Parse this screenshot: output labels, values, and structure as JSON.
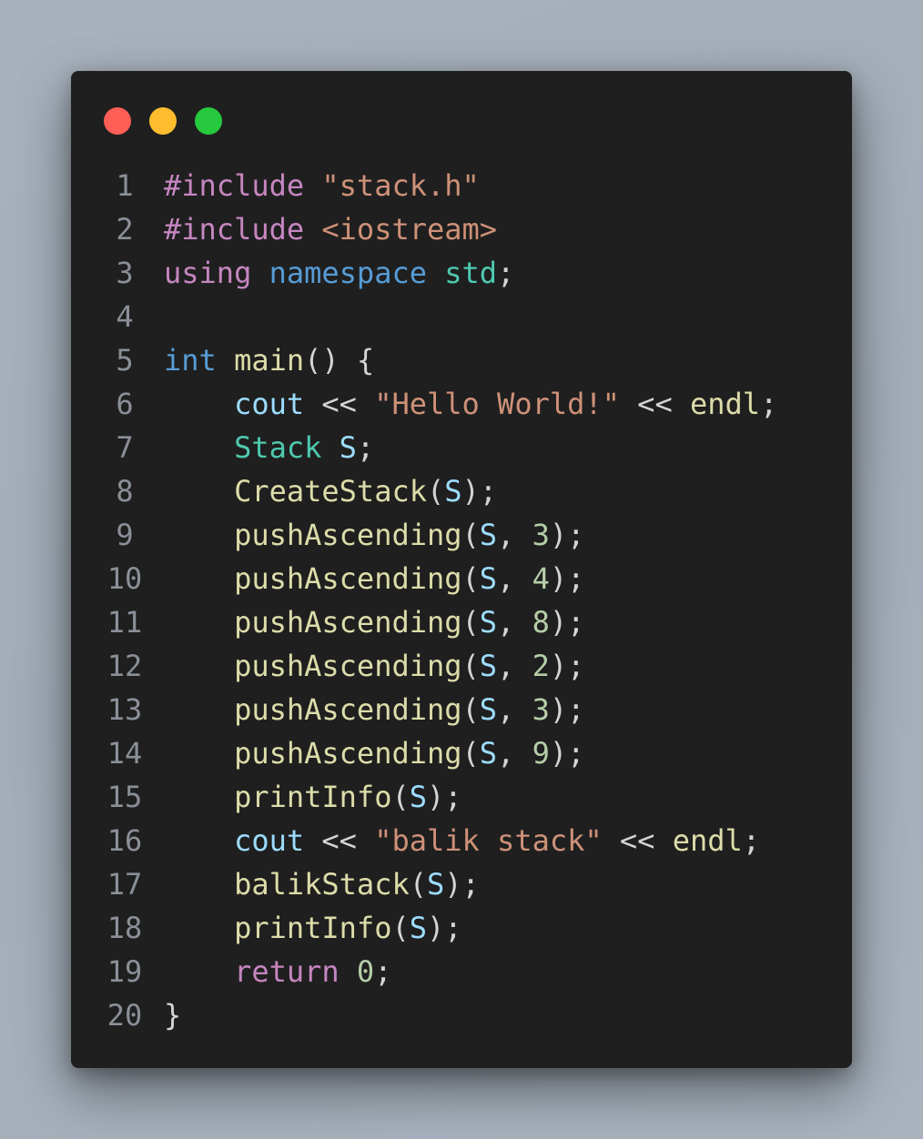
{
  "window": {
    "controls": [
      {
        "name": "close",
        "color": "#ff5f56"
      },
      {
        "name": "minimize",
        "color": "#ffbd2e"
      },
      {
        "name": "maximize",
        "color": "#27c93f"
      }
    ]
  },
  "code": {
    "language": "cpp",
    "lines": [
      {
        "num": "1",
        "tokens": [
          {
            "t": "#include",
            "c": "kw"
          },
          {
            "t": " ",
            "c": "pl"
          },
          {
            "t": "\"stack.h\"",
            "c": "str"
          }
        ]
      },
      {
        "num": "2",
        "tokens": [
          {
            "t": "#include",
            "c": "kw"
          },
          {
            "t": " ",
            "c": "pl"
          },
          {
            "t": "<iostream>",
            "c": "str"
          }
        ]
      },
      {
        "num": "3",
        "tokens": [
          {
            "t": "using",
            "c": "kw"
          },
          {
            "t": " ",
            "c": "pl"
          },
          {
            "t": "namespace",
            "c": "kb"
          },
          {
            "t": " ",
            "c": "pl"
          },
          {
            "t": "std",
            "c": "type"
          },
          {
            "t": ";",
            "c": "pl"
          }
        ]
      },
      {
        "num": "4",
        "tokens": []
      },
      {
        "num": "5",
        "tokens": [
          {
            "t": "int",
            "c": "kb"
          },
          {
            "t": " ",
            "c": "pl"
          },
          {
            "t": "main",
            "c": "fn"
          },
          {
            "t": "() {",
            "c": "pl"
          }
        ]
      },
      {
        "num": "6",
        "tokens": [
          {
            "t": "    ",
            "c": "pl"
          },
          {
            "t": "cout",
            "c": "var"
          },
          {
            "t": " << ",
            "c": "pl"
          },
          {
            "t": "\"Hello World!\"",
            "c": "str"
          },
          {
            "t": " << ",
            "c": "pl"
          },
          {
            "t": "endl",
            "c": "fn"
          },
          {
            "t": ";",
            "c": "pl"
          }
        ]
      },
      {
        "num": "7",
        "tokens": [
          {
            "t": "    ",
            "c": "pl"
          },
          {
            "t": "Stack",
            "c": "type"
          },
          {
            "t": " ",
            "c": "pl"
          },
          {
            "t": "S",
            "c": "var"
          },
          {
            "t": ";",
            "c": "pl"
          }
        ]
      },
      {
        "num": "8",
        "tokens": [
          {
            "t": "    ",
            "c": "pl"
          },
          {
            "t": "CreateStack",
            "c": "fn"
          },
          {
            "t": "(",
            "c": "pl"
          },
          {
            "t": "S",
            "c": "var"
          },
          {
            "t": ");",
            "c": "pl"
          }
        ]
      },
      {
        "num": "9",
        "tokens": [
          {
            "t": "    ",
            "c": "pl"
          },
          {
            "t": "pushAscending",
            "c": "fn"
          },
          {
            "t": "(",
            "c": "pl"
          },
          {
            "t": "S",
            "c": "var"
          },
          {
            "t": ", ",
            "c": "pl"
          },
          {
            "t": "3",
            "c": "num"
          },
          {
            "t": ");",
            "c": "pl"
          }
        ]
      },
      {
        "num": "10",
        "tokens": [
          {
            "t": "    ",
            "c": "pl"
          },
          {
            "t": "pushAscending",
            "c": "fn"
          },
          {
            "t": "(",
            "c": "pl"
          },
          {
            "t": "S",
            "c": "var"
          },
          {
            "t": ", ",
            "c": "pl"
          },
          {
            "t": "4",
            "c": "num"
          },
          {
            "t": ");",
            "c": "pl"
          }
        ]
      },
      {
        "num": "11",
        "tokens": [
          {
            "t": "    ",
            "c": "pl"
          },
          {
            "t": "pushAscending",
            "c": "fn"
          },
          {
            "t": "(",
            "c": "pl"
          },
          {
            "t": "S",
            "c": "var"
          },
          {
            "t": ", ",
            "c": "pl"
          },
          {
            "t": "8",
            "c": "num"
          },
          {
            "t": ");",
            "c": "pl"
          }
        ]
      },
      {
        "num": "12",
        "tokens": [
          {
            "t": "    ",
            "c": "pl"
          },
          {
            "t": "pushAscending",
            "c": "fn"
          },
          {
            "t": "(",
            "c": "pl"
          },
          {
            "t": "S",
            "c": "var"
          },
          {
            "t": ", ",
            "c": "pl"
          },
          {
            "t": "2",
            "c": "num"
          },
          {
            "t": ");",
            "c": "pl"
          }
        ]
      },
      {
        "num": "13",
        "tokens": [
          {
            "t": "    ",
            "c": "pl"
          },
          {
            "t": "pushAscending",
            "c": "fn"
          },
          {
            "t": "(",
            "c": "pl"
          },
          {
            "t": "S",
            "c": "var"
          },
          {
            "t": ", ",
            "c": "pl"
          },
          {
            "t": "3",
            "c": "num"
          },
          {
            "t": ");",
            "c": "pl"
          }
        ]
      },
      {
        "num": "14",
        "tokens": [
          {
            "t": "    ",
            "c": "pl"
          },
          {
            "t": "pushAscending",
            "c": "fn"
          },
          {
            "t": "(",
            "c": "pl"
          },
          {
            "t": "S",
            "c": "var"
          },
          {
            "t": ", ",
            "c": "pl"
          },
          {
            "t": "9",
            "c": "num"
          },
          {
            "t": ");",
            "c": "pl"
          }
        ]
      },
      {
        "num": "15",
        "tokens": [
          {
            "t": "    ",
            "c": "pl"
          },
          {
            "t": "printInfo",
            "c": "fn"
          },
          {
            "t": "(",
            "c": "pl"
          },
          {
            "t": "S",
            "c": "var"
          },
          {
            "t": ");",
            "c": "pl"
          }
        ]
      },
      {
        "num": "16",
        "tokens": [
          {
            "t": "    ",
            "c": "pl"
          },
          {
            "t": "cout",
            "c": "var"
          },
          {
            "t": " << ",
            "c": "pl"
          },
          {
            "t": "\"balik stack\"",
            "c": "str"
          },
          {
            "t": " << ",
            "c": "pl"
          },
          {
            "t": "endl",
            "c": "fn"
          },
          {
            "t": ";",
            "c": "pl"
          }
        ]
      },
      {
        "num": "17",
        "tokens": [
          {
            "t": "    ",
            "c": "pl"
          },
          {
            "t": "balikStack",
            "c": "fn"
          },
          {
            "t": "(",
            "c": "pl"
          },
          {
            "t": "S",
            "c": "var"
          },
          {
            "t": ");",
            "c": "pl"
          }
        ]
      },
      {
        "num": "18",
        "tokens": [
          {
            "t": "    ",
            "c": "pl"
          },
          {
            "t": "printInfo",
            "c": "fn"
          },
          {
            "t": "(",
            "c": "pl"
          },
          {
            "t": "S",
            "c": "var"
          },
          {
            "t": ");",
            "c": "pl"
          }
        ]
      },
      {
        "num": "19",
        "tokens": [
          {
            "t": "    ",
            "c": "pl"
          },
          {
            "t": "return",
            "c": "kw"
          },
          {
            "t": " ",
            "c": "pl"
          },
          {
            "t": "0",
            "c": "num"
          },
          {
            "t": ";",
            "c": "pl"
          }
        ]
      },
      {
        "num": "20",
        "tokens": [
          {
            "t": "}",
            "c": "pl"
          }
        ]
      }
    ]
  },
  "colors": {
    "background": "#a6b0bb",
    "window": "#1f1f1f",
    "line_number": "#8a8f98",
    "keyword_control": "#c586c0",
    "string": "#ce9178",
    "keyword_builtin": "#569cd6",
    "type": "#4ec9b0",
    "function": "#dcdcaa",
    "variable": "#9cdcfe",
    "number": "#b5cea8",
    "plain": "#d4d4d4"
  }
}
